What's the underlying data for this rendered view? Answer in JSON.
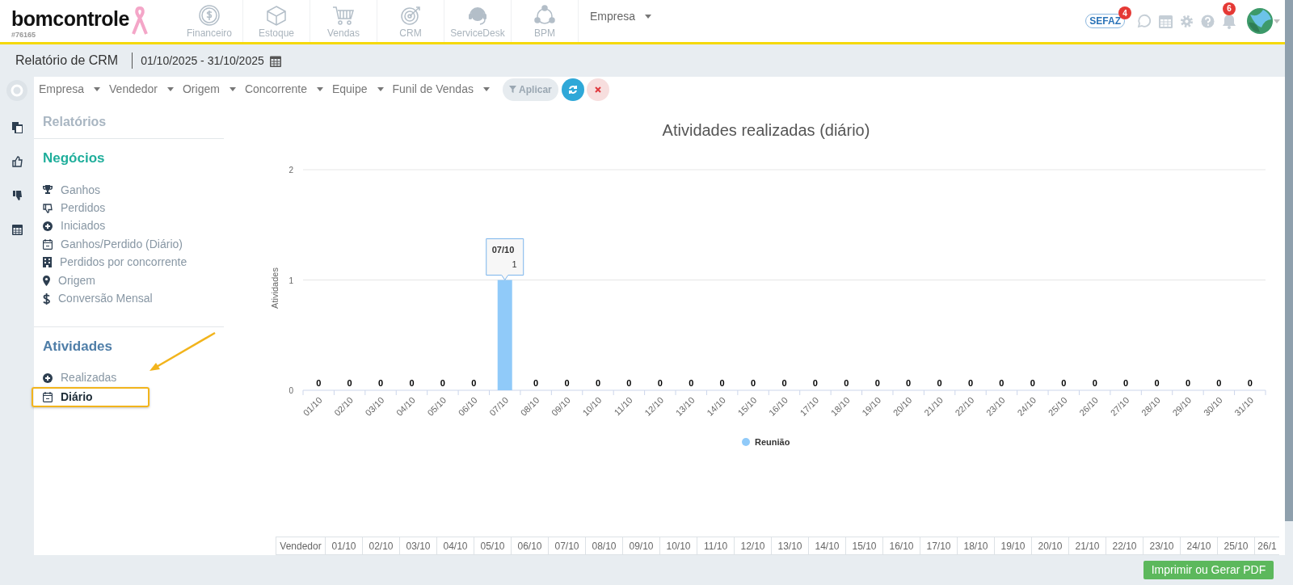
{
  "header": {
    "logo": "bomcontrole",
    "account": "#76165",
    "modules": [
      {
        "label": "Financeiro"
      },
      {
        "label": "Estoque"
      },
      {
        "label": "Vendas"
      },
      {
        "label": "CRM"
      },
      {
        "label": "ServiceDesk"
      },
      {
        "label": "BPM"
      }
    ],
    "company_menu": "Empresa",
    "sefaz": "SEFAZ",
    "sefaz_badge": "4",
    "notifications_badge": "6"
  },
  "page_title": "Relatório de CRM",
  "date_range": "01/10/2025 - 31/10/2025",
  "filters": [
    "Empresa",
    "Vendedor",
    "Origem",
    "Concorrente",
    "Equipe",
    "Funil de Vendas"
  ],
  "apply_button": "Aplicar",
  "sidebar": {
    "title": "Relatórios",
    "sections": [
      {
        "title": "Negócios",
        "items": [
          {
            "label": "Ganhos",
            "selected": false
          },
          {
            "label": "Perdidos",
            "selected": false
          },
          {
            "label": "Iniciados",
            "selected": false
          },
          {
            "label": "Ganhos/Perdido (Diário)",
            "selected": false
          },
          {
            "label": "Perdidos por concorrente",
            "selected": false
          },
          {
            "label": "Origem",
            "selected": false
          },
          {
            "label": "Conversão Mensal",
            "selected": false
          }
        ]
      },
      {
        "title": "Atividades",
        "items": [
          {
            "label": "Realizadas",
            "selected": false
          },
          {
            "label": "Diário",
            "selected": true
          }
        ]
      }
    ]
  },
  "chart": {
    "chart_data": {
      "type": "bar",
      "title": "Atividades realizadas (diário)",
      "ylabel": "Atividades",
      "categories": [
        "01/10",
        "02/10",
        "03/10",
        "04/10",
        "05/10",
        "06/10",
        "07/10",
        "08/10",
        "09/10",
        "10/10",
        "11/10",
        "12/10",
        "13/10",
        "14/10",
        "15/10",
        "16/10",
        "17/10",
        "18/10",
        "19/10",
        "20/10",
        "21/10",
        "22/10",
        "23/10",
        "24/10",
        "25/10",
        "26/10",
        "27/10",
        "28/10",
        "29/10",
        "30/10",
        "31/10"
      ],
      "series": [
        {
          "name": "Reunião",
          "color": "#90caf9",
          "values": [
            0,
            0,
            0,
            0,
            0,
            0,
            1,
            0,
            0,
            0,
            0,
            0,
            0,
            0,
            0,
            0,
            0,
            0,
            0,
            0,
            0,
            0,
            0,
            0,
            0,
            0,
            0,
            0,
            0,
            0,
            0
          ]
        }
      ],
      "ylim": [
        0,
        2
      ],
      "yticks": [
        0,
        1,
        2
      ],
      "data_labels": true
    },
    "tooltip": {
      "title": "07/10",
      "value": "1"
    }
  },
  "table": {
    "columns": [
      "Vendedor",
      "01/10",
      "02/10",
      "03/10",
      "04/10",
      "05/10",
      "06/10",
      "07/10",
      "08/10",
      "09/10",
      "10/10",
      "11/10",
      "12/10",
      "13/10",
      "14/10",
      "15/10",
      "16/10",
      "17/10",
      "18/10",
      "19/10",
      "20/10",
      "21/10",
      "22/10",
      "23/10",
      "24/10",
      "25/10",
      "26/1"
    ]
  },
  "print_button": "Imprimir ou Gerar PDF"
}
